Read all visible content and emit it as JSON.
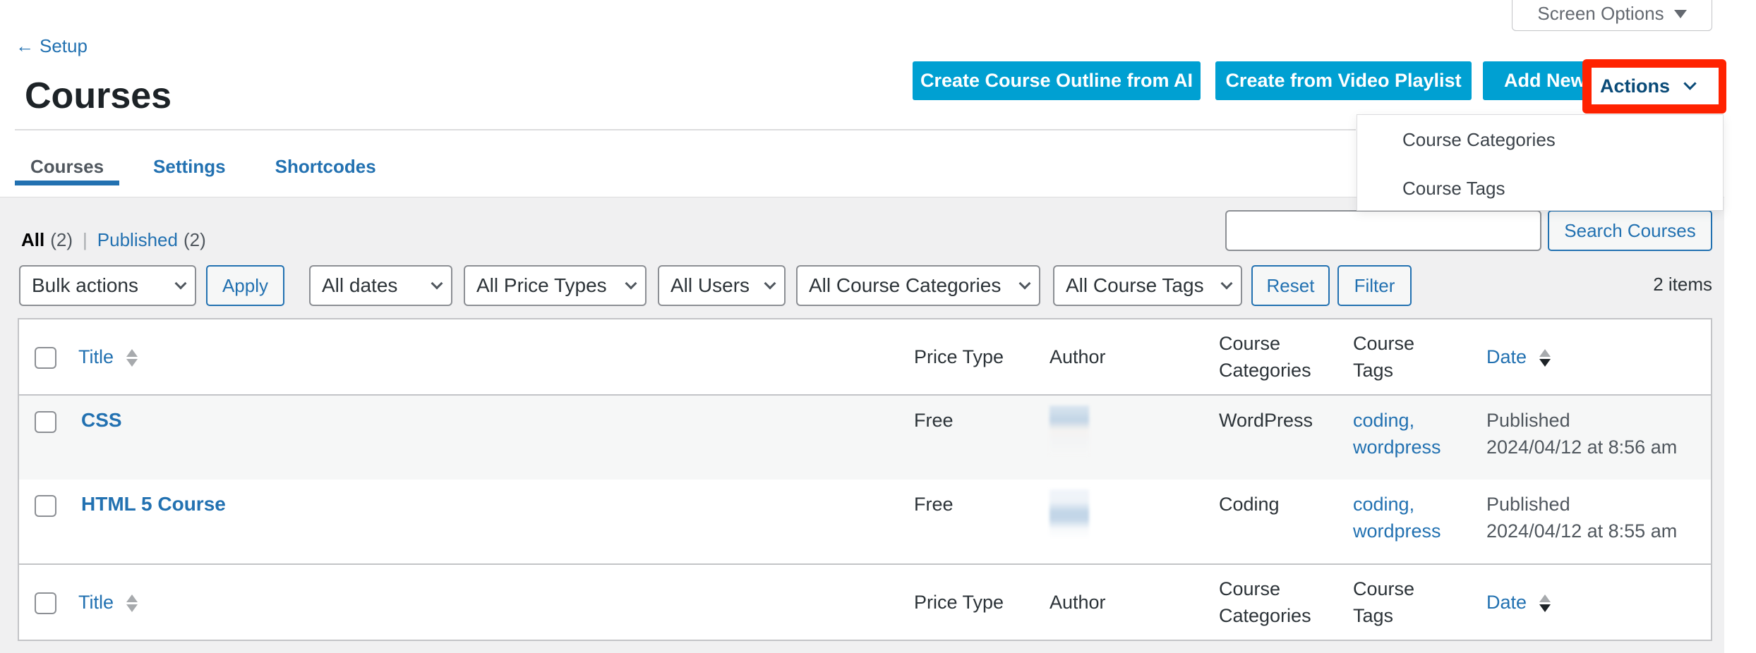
{
  "header": {
    "screen_options": "Screen Options",
    "back_link": "Setup",
    "title": "Courses",
    "buttons": {
      "outline_ai": "Create Course Outline from AI",
      "video_playlist": "Create from Video Playlist",
      "add_new": "Add New",
      "actions": "Actions"
    },
    "actions_menu": [
      "Course Categories",
      "Course Tags"
    ],
    "highlight_color": "#ff2200",
    "accent_color": "#00a0d2"
  },
  "tabs": [
    {
      "label": "Courses",
      "active": true
    },
    {
      "label": "Settings",
      "active": false
    },
    {
      "label": "Shortcodes",
      "active": false
    }
  ],
  "status_filters": {
    "all_label": "All",
    "all_count": "(2)",
    "separator": "|",
    "published_label": "Published",
    "published_count": "(2)"
  },
  "search": {
    "value": "",
    "button": "Search Courses"
  },
  "filters": {
    "bulk_actions": "Bulk actions",
    "apply": "Apply",
    "dates": "All dates",
    "price_types": "All Price Types",
    "users": "All Users",
    "categories": "All Course Categories",
    "tags": "All Course Tags",
    "reset": "Reset",
    "filter": "Filter",
    "items_count": "2 items"
  },
  "table": {
    "columns": {
      "title": "Title",
      "price_type": "Price Type",
      "author": "Author",
      "categories": "Course Categories",
      "tags": "Course Tags",
      "date": "Date"
    },
    "rows": [
      {
        "title": "CSS",
        "price_type": "Free",
        "author": "",
        "categories": "WordPress",
        "tags": [
          "coding,",
          "wordpress"
        ],
        "status": "Published",
        "date": "2024/04/12 at 8:56 am"
      },
      {
        "title": "HTML 5 Course",
        "price_type": "Free",
        "author": "",
        "categories": "Coding",
        "tags": [
          "coding,",
          "wordpress"
        ],
        "status": "Published",
        "date": "2024/04/12 at 8:55 am"
      }
    ]
  }
}
